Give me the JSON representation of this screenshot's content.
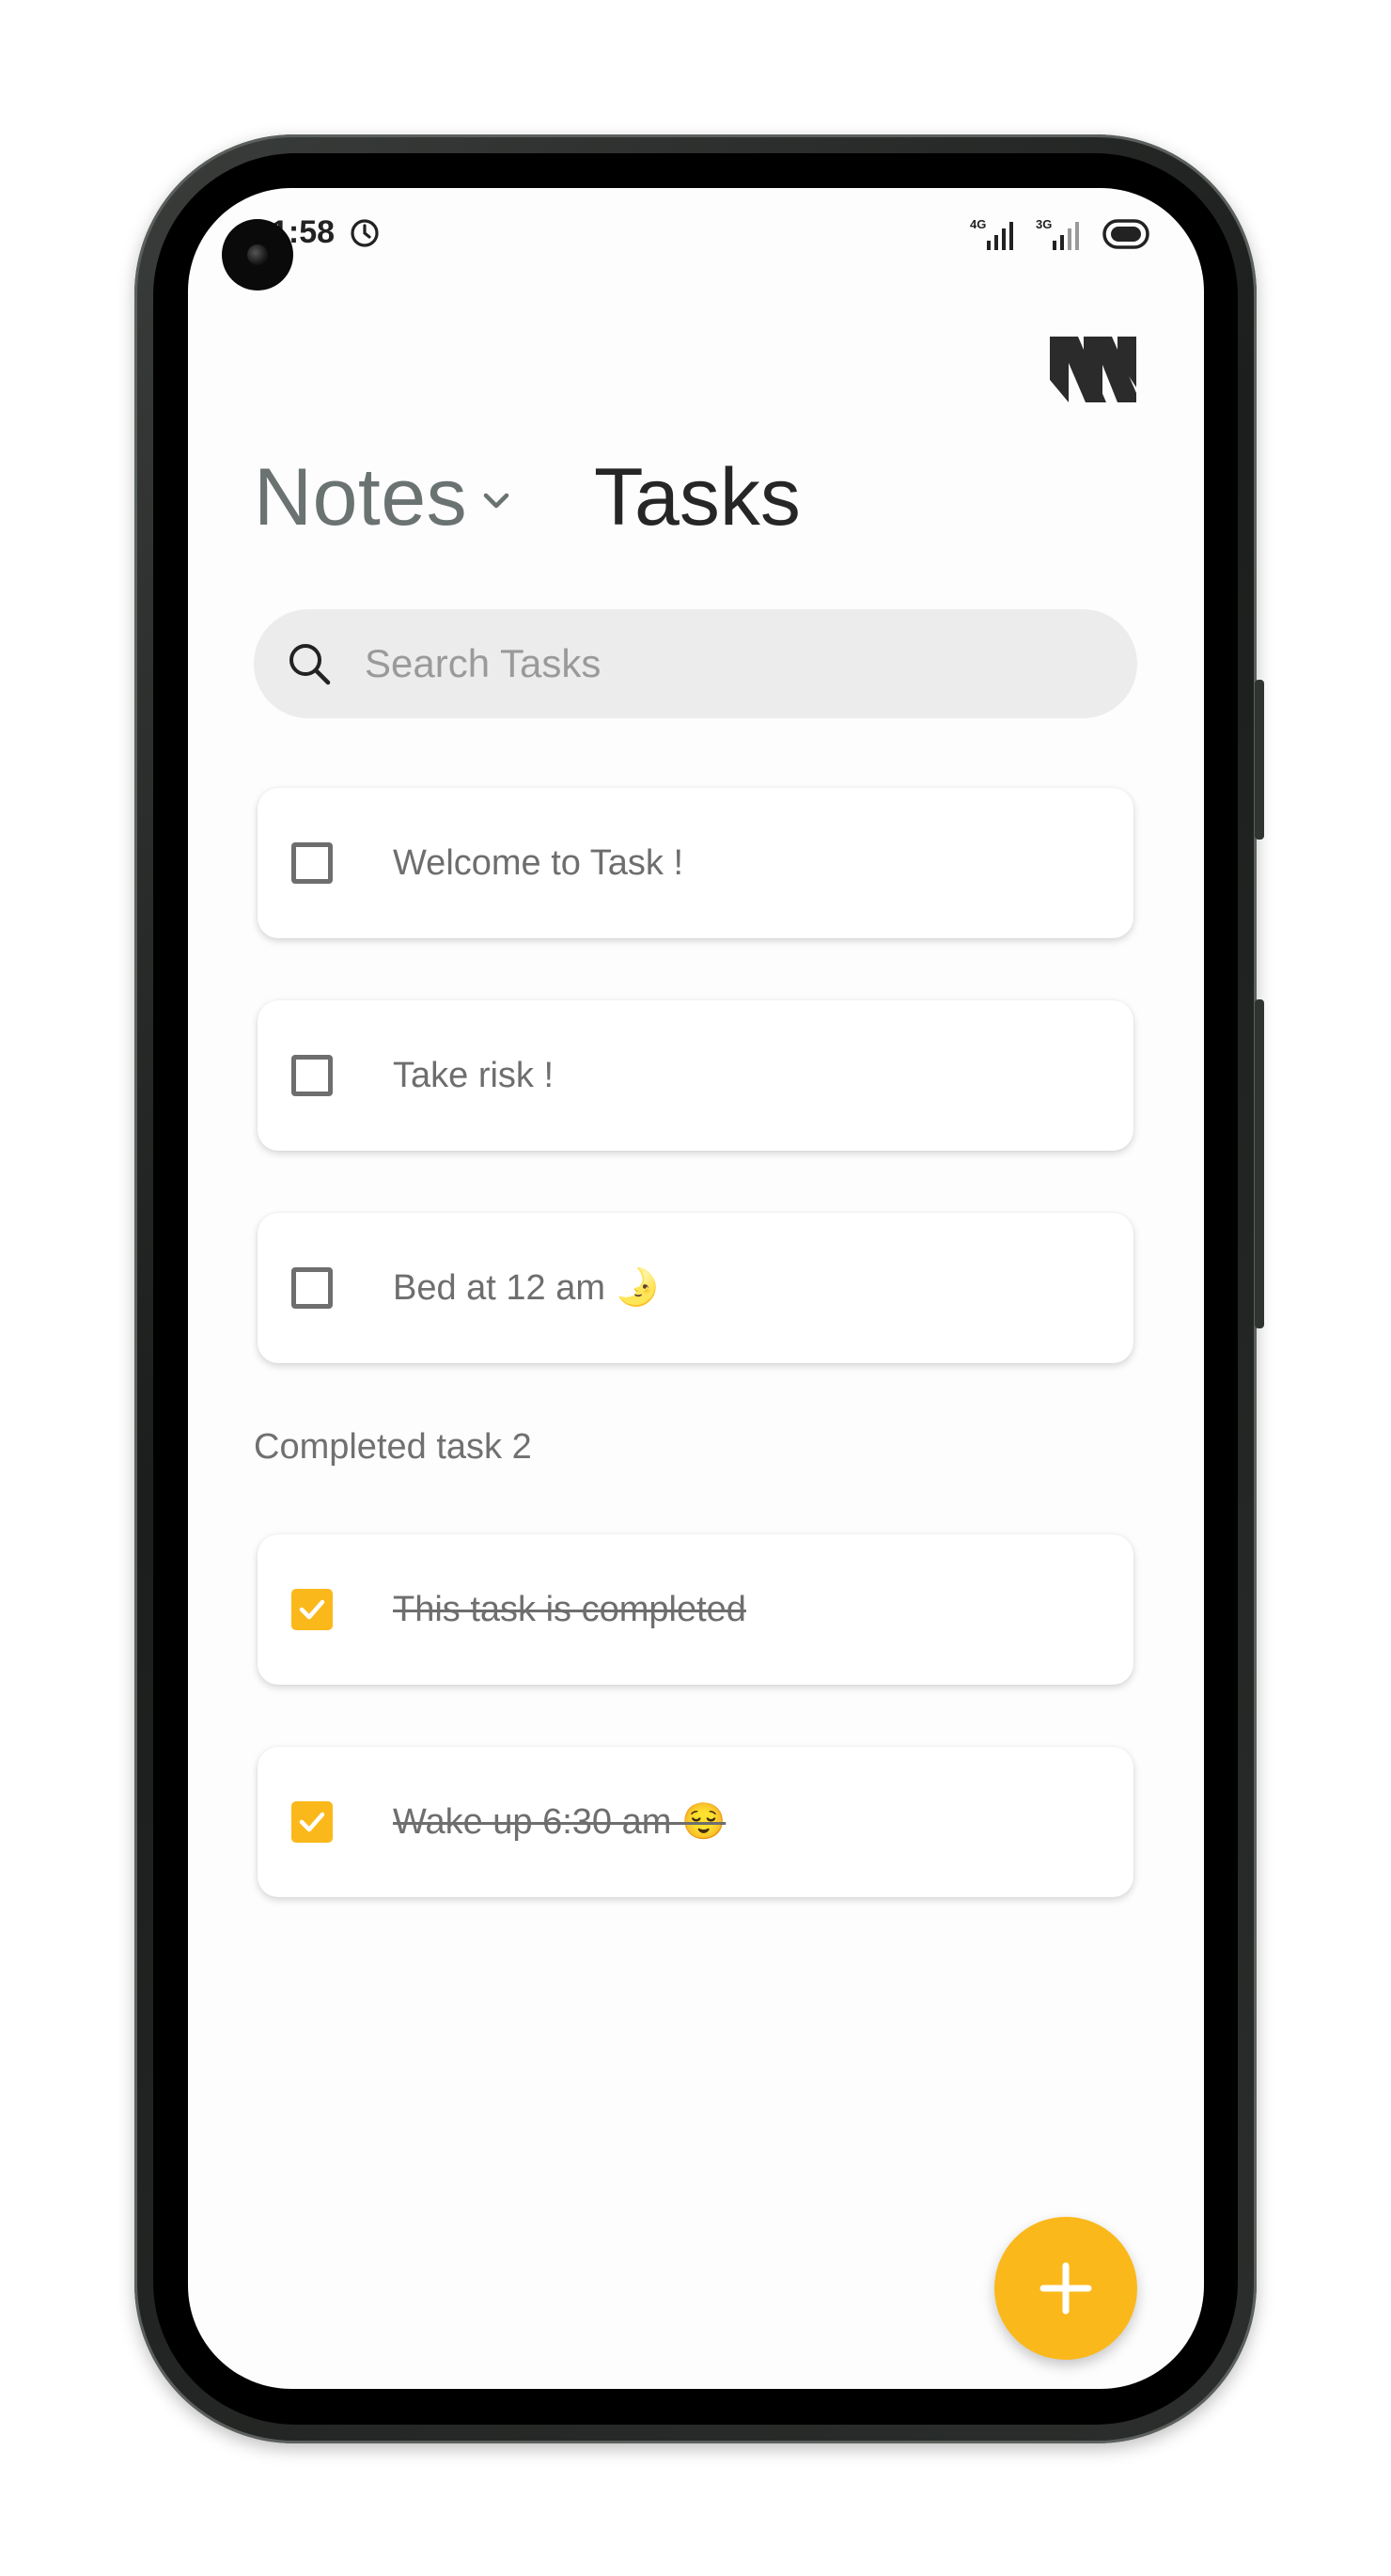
{
  "status_bar": {
    "time": "1:58",
    "alarm_icon": "alarm-clock-icon",
    "signal_1_label": "4G",
    "signal_2_label": "3G",
    "battery_icon": "battery-icon"
  },
  "app": {
    "logo_icon": "app-logo-icon",
    "tabs": [
      {
        "label": "Notes",
        "active": false,
        "has_dropdown": true
      },
      {
        "label": "Tasks",
        "active": true
      }
    ]
  },
  "search": {
    "placeholder": "Search Tasks",
    "value": ""
  },
  "tasks": {
    "pending": [
      {
        "text": "Welcome to Task !",
        "completed": false
      },
      {
        "text": "Take risk !",
        "completed": false
      },
      {
        "text": "Bed at 12 am 🌛",
        "completed": false
      }
    ],
    "completed_label": "Completed task 2",
    "completed": [
      {
        "text": "This task is completed",
        "completed": true
      },
      {
        "text": "Wake up 6:30 am 😌",
        "completed": true
      }
    ]
  },
  "fab": {
    "icon": "plus-icon",
    "action": "add task"
  },
  "colors": {
    "accent": "#fbb81b",
    "inactive_tab": "#6b7272",
    "active_tab": "#262626",
    "search_bg": "#ececec",
    "task_text": "#6e6e6e"
  }
}
